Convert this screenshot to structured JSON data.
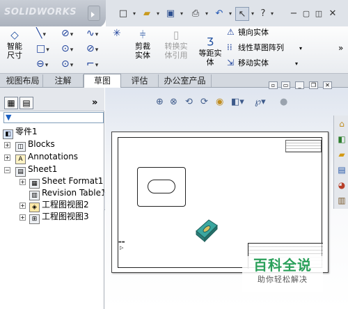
{
  "app": {
    "logo_text": "SOLIDWORKS"
  },
  "quick_access": {
    "items": [
      "new-icon",
      "open-icon",
      "save-icon",
      "print-icon",
      "undo-icon",
      "select-icon",
      "help-icon"
    ],
    "help_label": "?"
  },
  "command_manager": {
    "smart_dimension": "智能尺寸",
    "trim_entities": "剪裁实体",
    "convert_entities": "转换实体引用",
    "offset_entities": "等距实体",
    "mirror_entities": "镜向实体",
    "linear_pattern": "线性草图阵列",
    "move_entities": "移动实体"
  },
  "tabs": [
    {
      "label": "视图布局",
      "active": false
    },
    {
      "label": "注解",
      "active": false
    },
    {
      "label": "草图",
      "active": true
    },
    {
      "label": "评估",
      "active": false
    },
    {
      "label": "办公室产品",
      "active": false
    }
  ],
  "feature_manager": {
    "collapse_label": "»",
    "filter_icon": "funnel-icon",
    "tree": [
      {
        "label": "零件1",
        "level": 0,
        "icon": "part-icon"
      },
      {
        "label": "Blocks",
        "level": 1,
        "icon": "blocks-icon"
      },
      {
        "label": "Annotations",
        "level": 1,
        "icon": "annotations-icon"
      },
      {
        "label": "Sheet1",
        "level": 1,
        "icon": "sheet-icon"
      },
      {
        "label": "Sheet Format1",
        "level": 2,
        "icon": "sheet-format-icon"
      },
      {
        "label": "Revision Table1",
        "level": 2,
        "icon": "revision-table-icon"
      },
      {
        "label": "工程图视图2",
        "level": 2,
        "icon": "drawing-view-icon"
      },
      {
        "label": "工程图视图3",
        "level": 2,
        "icon": "drawing-view-icon"
      }
    ]
  },
  "graphics": {
    "heads_up_icons": [
      "zoom-to-fit-icon",
      "zoom-area-icon",
      "rotate-icon",
      "view-icon",
      "display-style-icon",
      "hide-show-icon",
      "scene-icon"
    ]
  },
  "watermark": {
    "title": "百科全说",
    "subtitle": "助你轻松解决"
  },
  "colors": {
    "sheet_border": "#444444",
    "iso_part": "#3aa7a0",
    "watermark_green": "#2aa05a"
  }
}
